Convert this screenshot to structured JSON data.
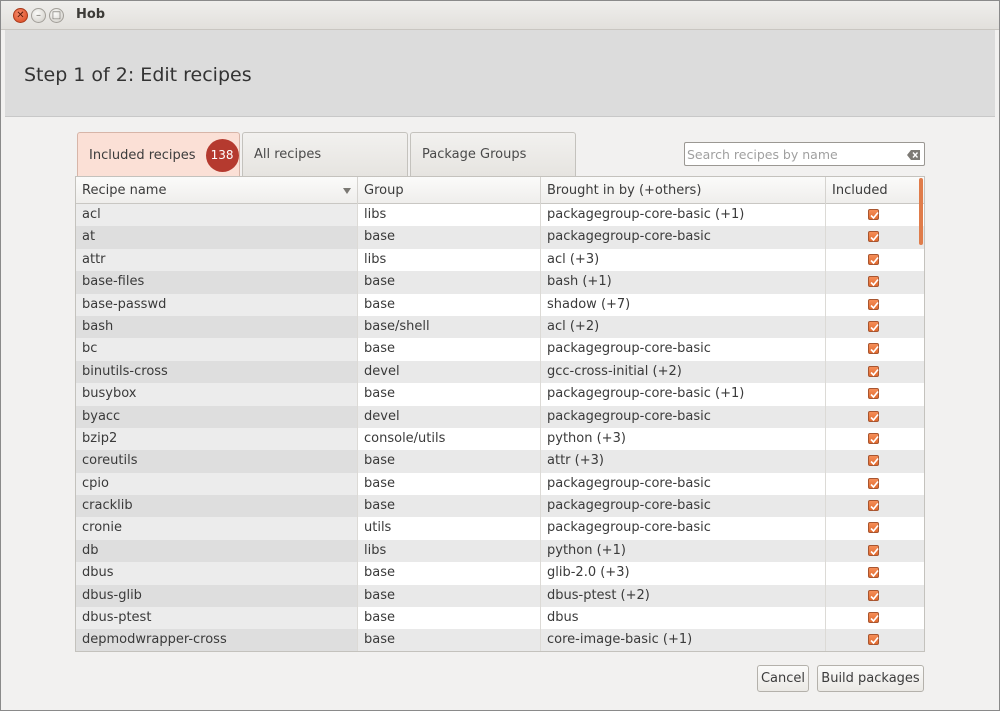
{
  "window": {
    "title": "Hob"
  },
  "header": {
    "title": "Step 1 of 2: Edit recipes"
  },
  "tabs": [
    {
      "label": "Included recipes",
      "badge": "138",
      "active": true
    },
    {
      "label": "All recipes",
      "active": false
    },
    {
      "label": "Package Groups",
      "active": false
    }
  ],
  "search": {
    "placeholder": "Search recipes by name",
    "value": ""
  },
  "table": {
    "columns": [
      "Recipe name",
      "Group",
      "Brought in by (+others)",
      "Included"
    ],
    "rows": [
      {
        "name": "acl",
        "group": "libs",
        "brought_in_by": "packagegroup-core-basic (+1)",
        "included": true
      },
      {
        "name": "at",
        "group": "base",
        "brought_in_by": "packagegroup-core-basic",
        "included": true
      },
      {
        "name": "attr",
        "group": "libs",
        "brought_in_by": "acl (+3)",
        "included": true
      },
      {
        "name": "base-files",
        "group": "base",
        "brought_in_by": "bash (+1)",
        "included": true
      },
      {
        "name": "base-passwd",
        "group": "base",
        "brought_in_by": "shadow (+7)",
        "included": true
      },
      {
        "name": "bash",
        "group": "base/shell",
        "brought_in_by": "acl (+2)",
        "included": true
      },
      {
        "name": "bc",
        "group": "base",
        "brought_in_by": "packagegroup-core-basic",
        "included": true
      },
      {
        "name": "binutils-cross",
        "group": "devel",
        "brought_in_by": "gcc-cross-initial (+2)",
        "included": true
      },
      {
        "name": "busybox",
        "group": "base",
        "brought_in_by": "packagegroup-core-basic (+1)",
        "included": true
      },
      {
        "name": "byacc",
        "group": "devel",
        "brought_in_by": "packagegroup-core-basic",
        "included": true
      },
      {
        "name": "bzip2",
        "group": "console/utils",
        "brought_in_by": "python (+3)",
        "included": true
      },
      {
        "name": "coreutils",
        "group": "base",
        "brought_in_by": "attr (+3)",
        "included": true
      },
      {
        "name": "cpio",
        "group": "base",
        "brought_in_by": "packagegroup-core-basic",
        "included": true
      },
      {
        "name": "cracklib",
        "group": "base",
        "brought_in_by": "packagegroup-core-basic",
        "included": true
      },
      {
        "name": "cronie",
        "group": "utils",
        "brought_in_by": "packagegroup-core-basic",
        "included": true
      },
      {
        "name": "db",
        "group": "libs",
        "brought_in_by": "python (+1)",
        "included": true
      },
      {
        "name": "dbus",
        "group": "base",
        "brought_in_by": "glib-2.0 (+3)",
        "included": true
      },
      {
        "name": "dbus-glib",
        "group": "base",
        "brought_in_by": "dbus-ptest (+2)",
        "included": true
      },
      {
        "name": "dbus-ptest",
        "group": "base",
        "brought_in_by": "dbus",
        "included": true
      },
      {
        "name": "depmodwrapper-cross",
        "group": "base",
        "brought_in_by": "core-image-basic (+1)",
        "included": true
      }
    ]
  },
  "buttons": {
    "cancel": "Cancel",
    "build": "Build packages"
  },
  "colors": {
    "accent": "#e16a2f",
    "badge": "#b53a2f",
    "active_tab": "#fbe0d6"
  }
}
